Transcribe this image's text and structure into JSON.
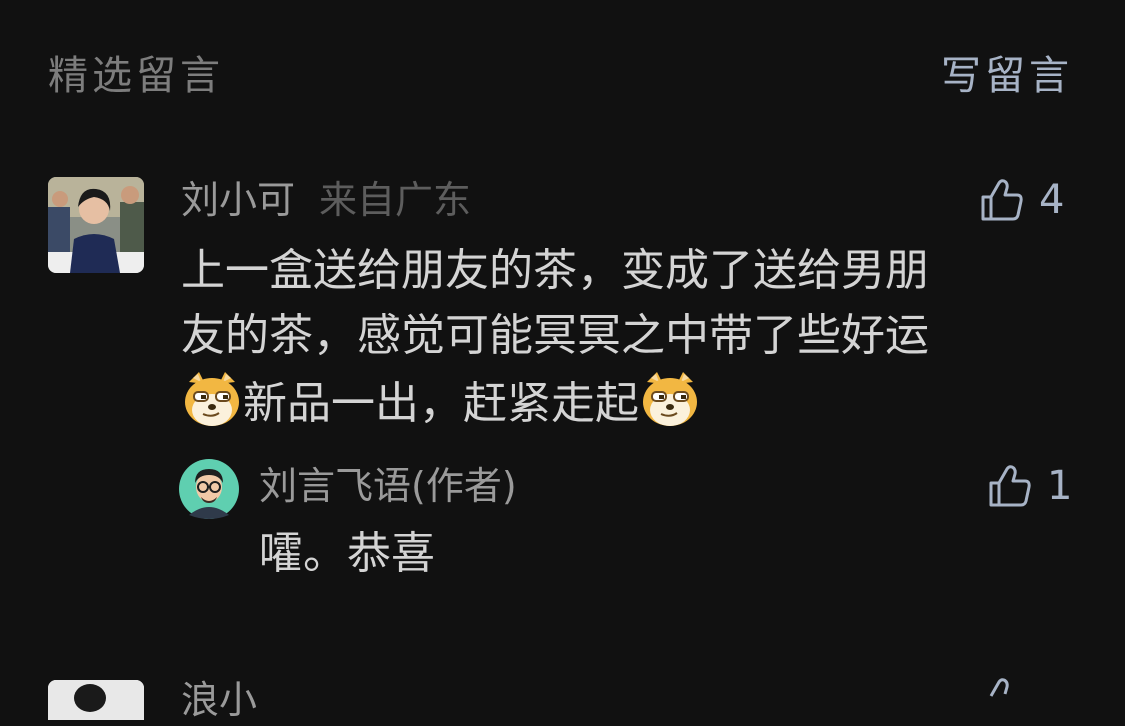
{
  "header": {
    "title": "精选留言",
    "write_label": "写留言"
  },
  "comments": [
    {
      "author": "刘小可",
      "location": "来自广东",
      "likes": "4",
      "lines": [
        "上一盒送给朋友的茶，变成了送给男朋",
        "友的茶，感觉可能冥冥之中带了些好运",
        "新品一出，赶紧走起"
      ],
      "emoji": "doge-emoji",
      "reply": {
        "author": "刘言飞语(作者)",
        "likes": "1",
        "text": "嚯。恭喜"
      }
    }
  ],
  "next_comment": {
    "author": "浪小"
  },
  "colors": {
    "background": "#111111",
    "accent": "#a7b3c6",
    "text": "#d4d4d4",
    "muted": "#9a9a9a"
  }
}
